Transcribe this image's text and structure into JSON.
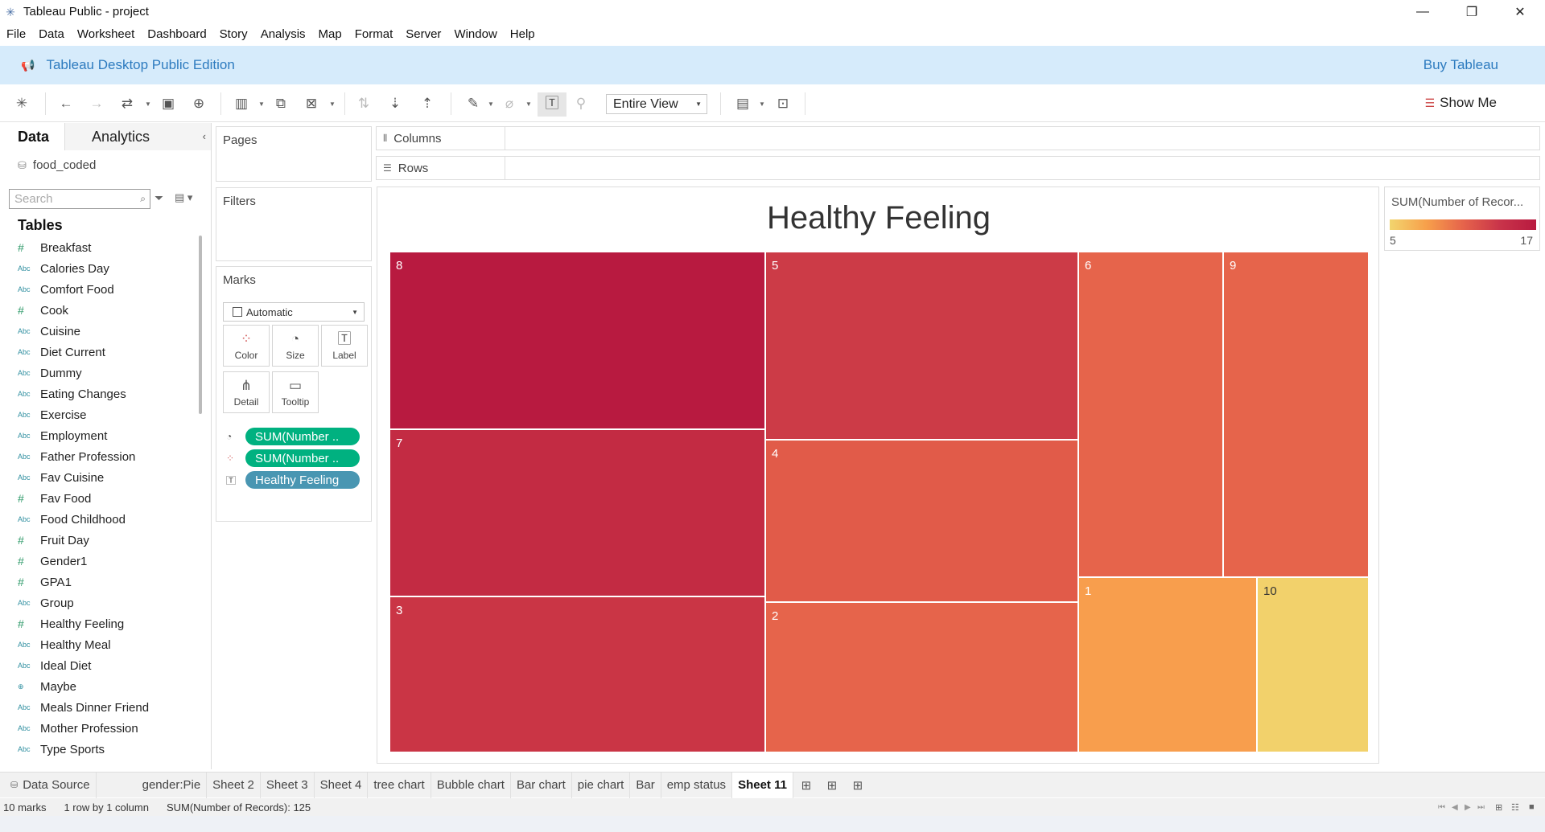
{
  "window": {
    "title": "Tableau Public - project"
  },
  "menu": [
    "File",
    "Data",
    "Worksheet",
    "Dashboard",
    "Story",
    "Analysis",
    "Map",
    "Format",
    "Server",
    "Window",
    "Help"
  ],
  "banner": {
    "edition": "Tableau Desktop Public Edition",
    "buy": "Buy Tableau"
  },
  "toolbar": {
    "fit": "Entire View",
    "show_me": "Show Me"
  },
  "side": {
    "tab_data": "Data",
    "tab_analytics": "Analytics",
    "datasource": "food_coded",
    "search_placeholder": "Search",
    "tables_heading": "Tables",
    "fields": [
      {
        "type": "num",
        "name": "Breakfast"
      },
      {
        "type": "abc",
        "name": "Calories Day"
      },
      {
        "type": "abc",
        "name": "Comfort Food"
      },
      {
        "type": "num",
        "name": "Cook"
      },
      {
        "type": "abc",
        "name": "Cuisine"
      },
      {
        "type": "abc",
        "name": "Diet Current"
      },
      {
        "type": "abc",
        "name": "Dummy"
      },
      {
        "type": "abc",
        "name": "Eating Changes"
      },
      {
        "type": "abc",
        "name": "Exercise"
      },
      {
        "type": "abc",
        "name": "Employment"
      },
      {
        "type": "abc",
        "name": "Father Profession"
      },
      {
        "type": "abc",
        "name": "Fav Cuisine"
      },
      {
        "type": "num",
        "name": "Fav Food"
      },
      {
        "type": "abc",
        "name": "Food Childhood"
      },
      {
        "type": "num",
        "name": "Fruit Day"
      },
      {
        "type": "num",
        "name": "Gender1"
      },
      {
        "type": "num",
        "name": "GPA1"
      },
      {
        "type": "abc",
        "name": "Group"
      },
      {
        "type": "num",
        "name": "Healthy Feeling"
      },
      {
        "type": "abc",
        "name": "Healthy Meal"
      },
      {
        "type": "abc",
        "name": "Ideal Diet"
      },
      {
        "type": "geo",
        "name": "Maybe"
      },
      {
        "type": "abc",
        "name": "Meals Dinner Friend"
      },
      {
        "type": "abc",
        "name": "Mother Profession"
      },
      {
        "type": "abc",
        "name": "Type Sports"
      }
    ]
  },
  "cards": {
    "pages": "Pages",
    "filters": "Filters",
    "marks": "Marks",
    "mark_type": "Automatic",
    "buttons": {
      "color": "Color",
      "size": "Size",
      "label": "Label",
      "detail": "Detail",
      "tooltip": "Tooltip"
    },
    "pills": [
      "SUM(Number ..",
      "SUM(Number ..",
      "Healthy Feeling"
    ]
  },
  "shelves": {
    "columns": "Columns",
    "rows": "Rows"
  },
  "viz": {
    "title": "Healthy Feeling",
    "tiles": [
      {
        "label": "8",
        "color": "#b81a40"
      },
      {
        "label": "7",
        "color": "#c32b43"
      },
      {
        "label": "3",
        "color": "#ca3545"
      },
      {
        "label": "5",
        "color": "#cc3b47"
      },
      {
        "label": "4",
        "color": "#e15b49"
      },
      {
        "label": "2",
        "color": "#e6644b"
      },
      {
        "label": "6",
        "color": "#e6644b"
      },
      {
        "label": "9",
        "color": "#e6644b"
      },
      {
        "label": "1",
        "color": "#f89e4d"
      },
      {
        "label": "10",
        "color": "#f2d16b"
      }
    ]
  },
  "legend": {
    "title": "SUM(Number of Recor...",
    "min": "5",
    "max": "17"
  },
  "sheet_tabs": [
    "Data Source",
    "gender:Pie",
    "Sheet 2",
    "Sheet 3",
    "Sheet 4",
    "tree chart",
    "Bubble chart",
    "Bar chart",
    "pie chart",
    "Bar",
    "emp status",
    "Sheet 11"
  ],
  "status": {
    "marks": "10 marks",
    "dims": "1 row by 1 column",
    "sum": "SUM(Number of Records): 125"
  }
}
